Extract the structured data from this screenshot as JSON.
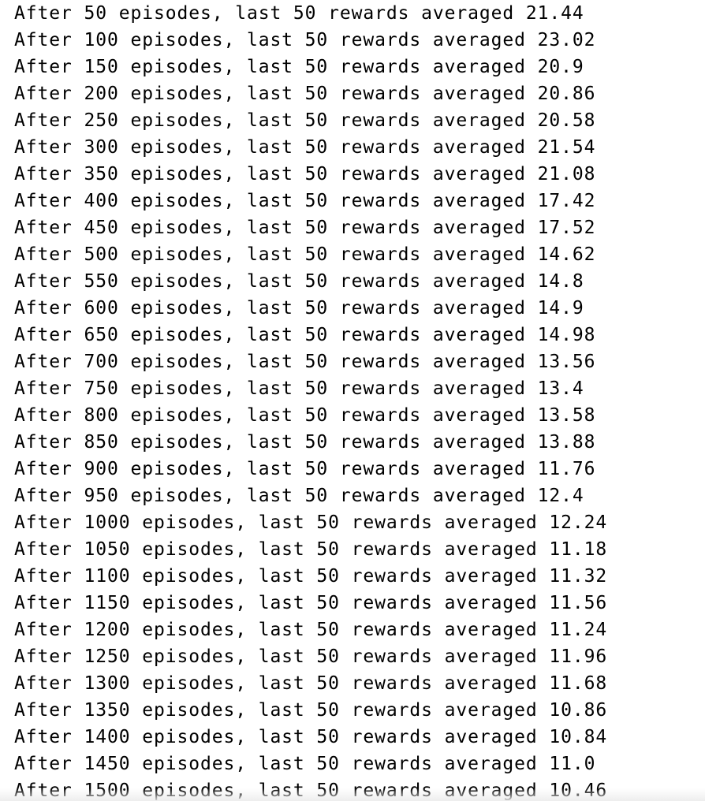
{
  "output": {
    "lines": [
      "After 50 episodes, last 50 rewards averaged 21.44",
      "After 100 episodes, last 50 rewards averaged 23.02",
      "After 150 episodes, last 50 rewards averaged 20.9",
      "After 200 episodes, last 50 rewards averaged 20.86",
      "After 250 episodes, last 50 rewards averaged 20.58",
      "After 300 episodes, last 50 rewards averaged 21.54",
      "After 350 episodes, last 50 rewards averaged 21.08",
      "After 400 episodes, last 50 rewards averaged 17.42",
      "After 450 episodes, last 50 rewards averaged 17.52",
      "After 500 episodes, last 50 rewards averaged 14.62",
      "After 550 episodes, last 50 rewards averaged 14.8",
      "After 600 episodes, last 50 rewards averaged 14.9",
      "After 650 episodes, last 50 rewards averaged 14.98",
      "After 700 episodes, last 50 rewards averaged 13.56",
      "After 750 episodes, last 50 rewards averaged 13.4",
      "After 800 episodes, last 50 rewards averaged 13.58",
      "After 850 episodes, last 50 rewards averaged 13.88",
      "After 900 episodes, last 50 rewards averaged 11.76",
      "After 950 episodes, last 50 rewards averaged 12.4",
      "After 1000 episodes, last 50 rewards averaged 12.24",
      "After 1050 episodes, last 50 rewards averaged 11.18",
      "After 1100 episodes, last 50 rewards averaged 11.32",
      "After 1150 episodes, last 50 rewards averaged 11.56",
      "After 1200 episodes, last 50 rewards averaged 11.24",
      "After 1250 episodes, last 50 rewards averaged 11.96",
      "After 1300 episodes, last 50 rewards averaged 11.68",
      "After 1350 episodes, last 50 rewards averaged 10.86",
      "After 1400 episodes, last 50 rewards averaged 10.84",
      "After 1450 episodes, last 50 rewards averaged 11.0",
      "After 1500 episodes, last 50 rewards averaged 10.46"
    ]
  }
}
